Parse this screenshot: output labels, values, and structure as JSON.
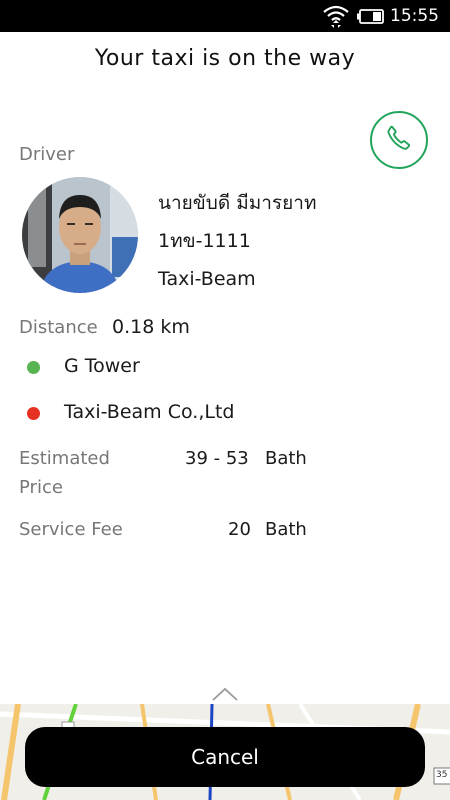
{
  "status_bar": {
    "time": "15:55"
  },
  "header": {
    "title": "Your taxi is on the way"
  },
  "driver": {
    "label": "Driver",
    "name": "นายขับดี มีมารยาท",
    "plate": "1ทข-1111",
    "company": "Taxi-Beam"
  },
  "distance": {
    "label": "Distance",
    "value": "0.18 km"
  },
  "pickup": {
    "name": "G Tower",
    "color": "#58b452"
  },
  "destination": {
    "name": "Taxi-Beam Co.,Ltd",
    "color": "#e63122"
  },
  "estimated_price": {
    "label_line1": "Estimated",
    "label_line2": "Price",
    "value": "39 - 53",
    "unit": "Bath"
  },
  "service_fee": {
    "label": "Service Fee",
    "value": "20",
    "unit": "Bath"
  },
  "map": {
    "road_number": "35"
  },
  "actions": {
    "cancel_label": "Cancel"
  },
  "colors": {
    "accent_green": "#21a45a",
    "button_black": "#000000"
  }
}
